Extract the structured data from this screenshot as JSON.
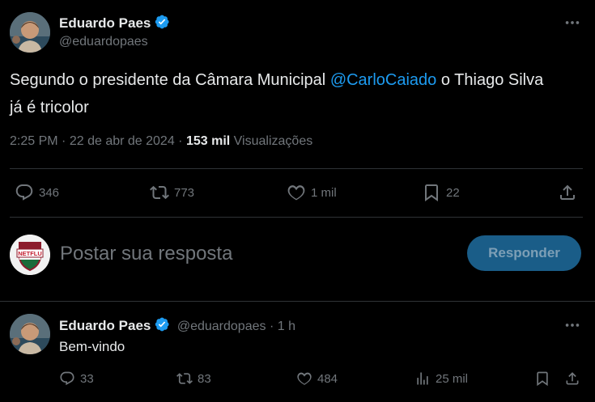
{
  "main_tweet": {
    "author_name": "Eduardo Paes",
    "author_handle": "@eduardopaes",
    "text_before": "Segundo o presidente da Câmara Municipal ",
    "mention": "@CarloCaiado",
    "text_after": " o Thiago Silva",
    "text_line2": "já é tricolor",
    "time": "2:25 PM",
    "date": "22 de abr de 2024",
    "views_count": "153 mil",
    "views_label": "Visualizações",
    "replies": "346",
    "reposts": "773",
    "likes": "1 mil",
    "bookmarks": "22"
  },
  "reply_box": {
    "placeholder": "Postar sua resposta",
    "button_label": "Responder",
    "crest_text": "NETFLU"
  },
  "reply_tweet": {
    "author_name": "Eduardo Paes",
    "author_handle": "@eduardopaes",
    "separator": "·",
    "time_ago": "1 h",
    "text": "Bem-vindo",
    "replies": "33",
    "reposts": "83",
    "likes": "484",
    "views": "25 mil"
  },
  "colors": {
    "background": "#000000",
    "accent": "#1d9bf0",
    "muted": "#71767b",
    "text": "#e7e9ea",
    "button_bg": "#1a5d88"
  },
  "icons": [
    "verified-badge-icon",
    "more-icon",
    "reply-icon",
    "repost-icon",
    "like-icon",
    "bookmark-icon",
    "share-icon",
    "views-icon"
  ]
}
